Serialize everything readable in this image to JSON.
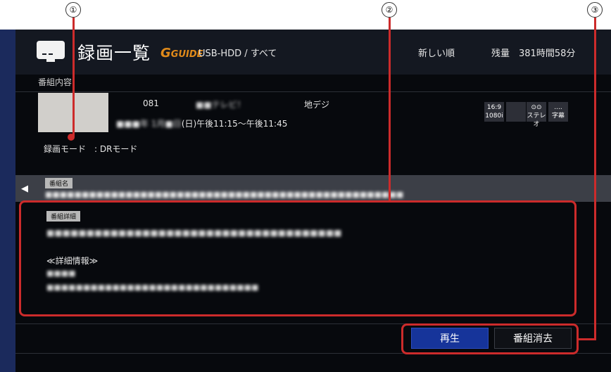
{
  "callouts": [
    "①",
    "②",
    "③"
  ],
  "header": {
    "title": "録画一覧",
    "guide_logo": "GUIDE",
    "source": "USB-HDD / すべて",
    "sort": "新しい順",
    "remaining": "残量　381時間58分"
  },
  "info": {
    "section_label": "番組内容",
    "channel": "081",
    "station": "■■テレビ！",
    "broadcast_type": "地デジ",
    "date_prefix": "■■■年 1月■日",
    "date_rest": "(日)午後11:15〜午後11:45",
    "rec_mode": "録画モード　: DRモード",
    "badges": {
      "aspect": "16:9",
      "resolution": "1080i",
      "stereo": "ステレオ",
      "subtitles": "字幕"
    }
  },
  "program_name": {
    "tag": "番組名",
    "text": "■■■■■■■■■■■■■■■■■■■■■■■■■■■■■■■■■■■■■■■■■■■■■■■■■"
  },
  "program_detail": {
    "tag": "番組詳細",
    "line1": "■■■■■■■■■■■■■■■■■■■■■■■■■■■■■■■■■■■■■",
    "info_header": "≪詳細情報≫",
    "line2": "■■■■",
    "line3": "■■■■■■■■■■■■■■■■■■■■■■■■■■■■■"
  },
  "buttons": {
    "play": "再生",
    "delete": "番組消去"
  },
  "colors": {
    "play_button": "#16349a",
    "callout": "#cc2b2b",
    "left_bar": "#1b2a5c"
  }
}
